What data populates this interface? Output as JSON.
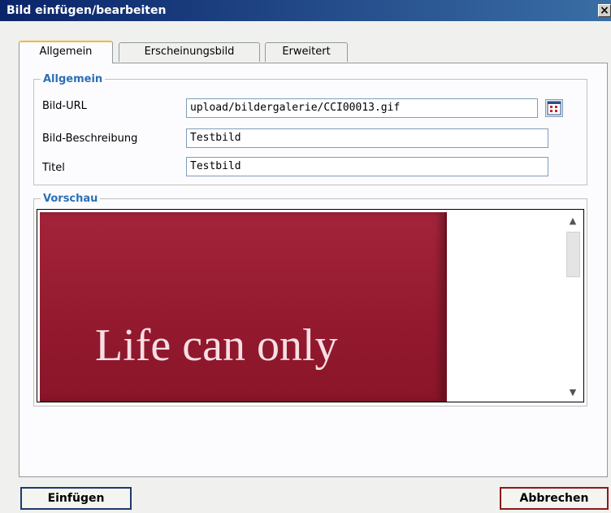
{
  "dialog": {
    "title": "Bild einfügen/bearbeiten",
    "close_glyph": "×"
  },
  "tabs": [
    {
      "label": "Allgemein",
      "active": true
    },
    {
      "label": "Erscheinungsbild",
      "active": false
    },
    {
      "label": "Erweitert",
      "active": false
    }
  ],
  "general": {
    "legend": "Allgemein",
    "url_label": "Bild-URL",
    "url_value": "upload/bildergalerie/CCI00013.gif",
    "browse_icon": "calendar-grid-icon",
    "description_label": "Bild-Beschreibung",
    "description_value": "Testbild",
    "title_label": "Titel",
    "title_value": "Testbild"
  },
  "preview": {
    "legend": "Vorschau",
    "image_text": "Life can only",
    "image_color": "#9b1e35"
  },
  "buttons": {
    "insert": "Einfügen",
    "cancel": "Abbrechen"
  }
}
